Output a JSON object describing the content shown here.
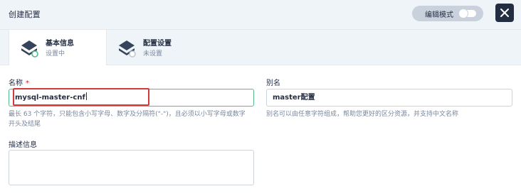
{
  "header": {
    "title": "创建配置",
    "edit_mode_label": "编辑模式",
    "close_label": "close"
  },
  "steps": [
    {
      "name": "基本信息",
      "status": "设置中"
    },
    {
      "name": "配置设置",
      "status": "未设置"
    }
  ],
  "form": {
    "name": {
      "label": "名称",
      "required_mark": "*",
      "value": "mysql-master-cnf",
      "hint_line1": "最长 63 个字符，只能包含小写字母、数字及分隔符(\"-\")，且必须以小写字母或数字",
      "hint_line2": "开头及结尾"
    },
    "alias": {
      "label": "别名",
      "value": "master配置",
      "hint": "别名可以由任意字符组成，帮助您更好的区分资源，并支持中文名称"
    },
    "description": {
      "label": "描述信息",
      "value": ""
    }
  },
  "colors": {
    "accent": "#55bc8a",
    "highlight": "#d23b3b",
    "dark": "#242e42",
    "bg": "#eff4f9"
  }
}
